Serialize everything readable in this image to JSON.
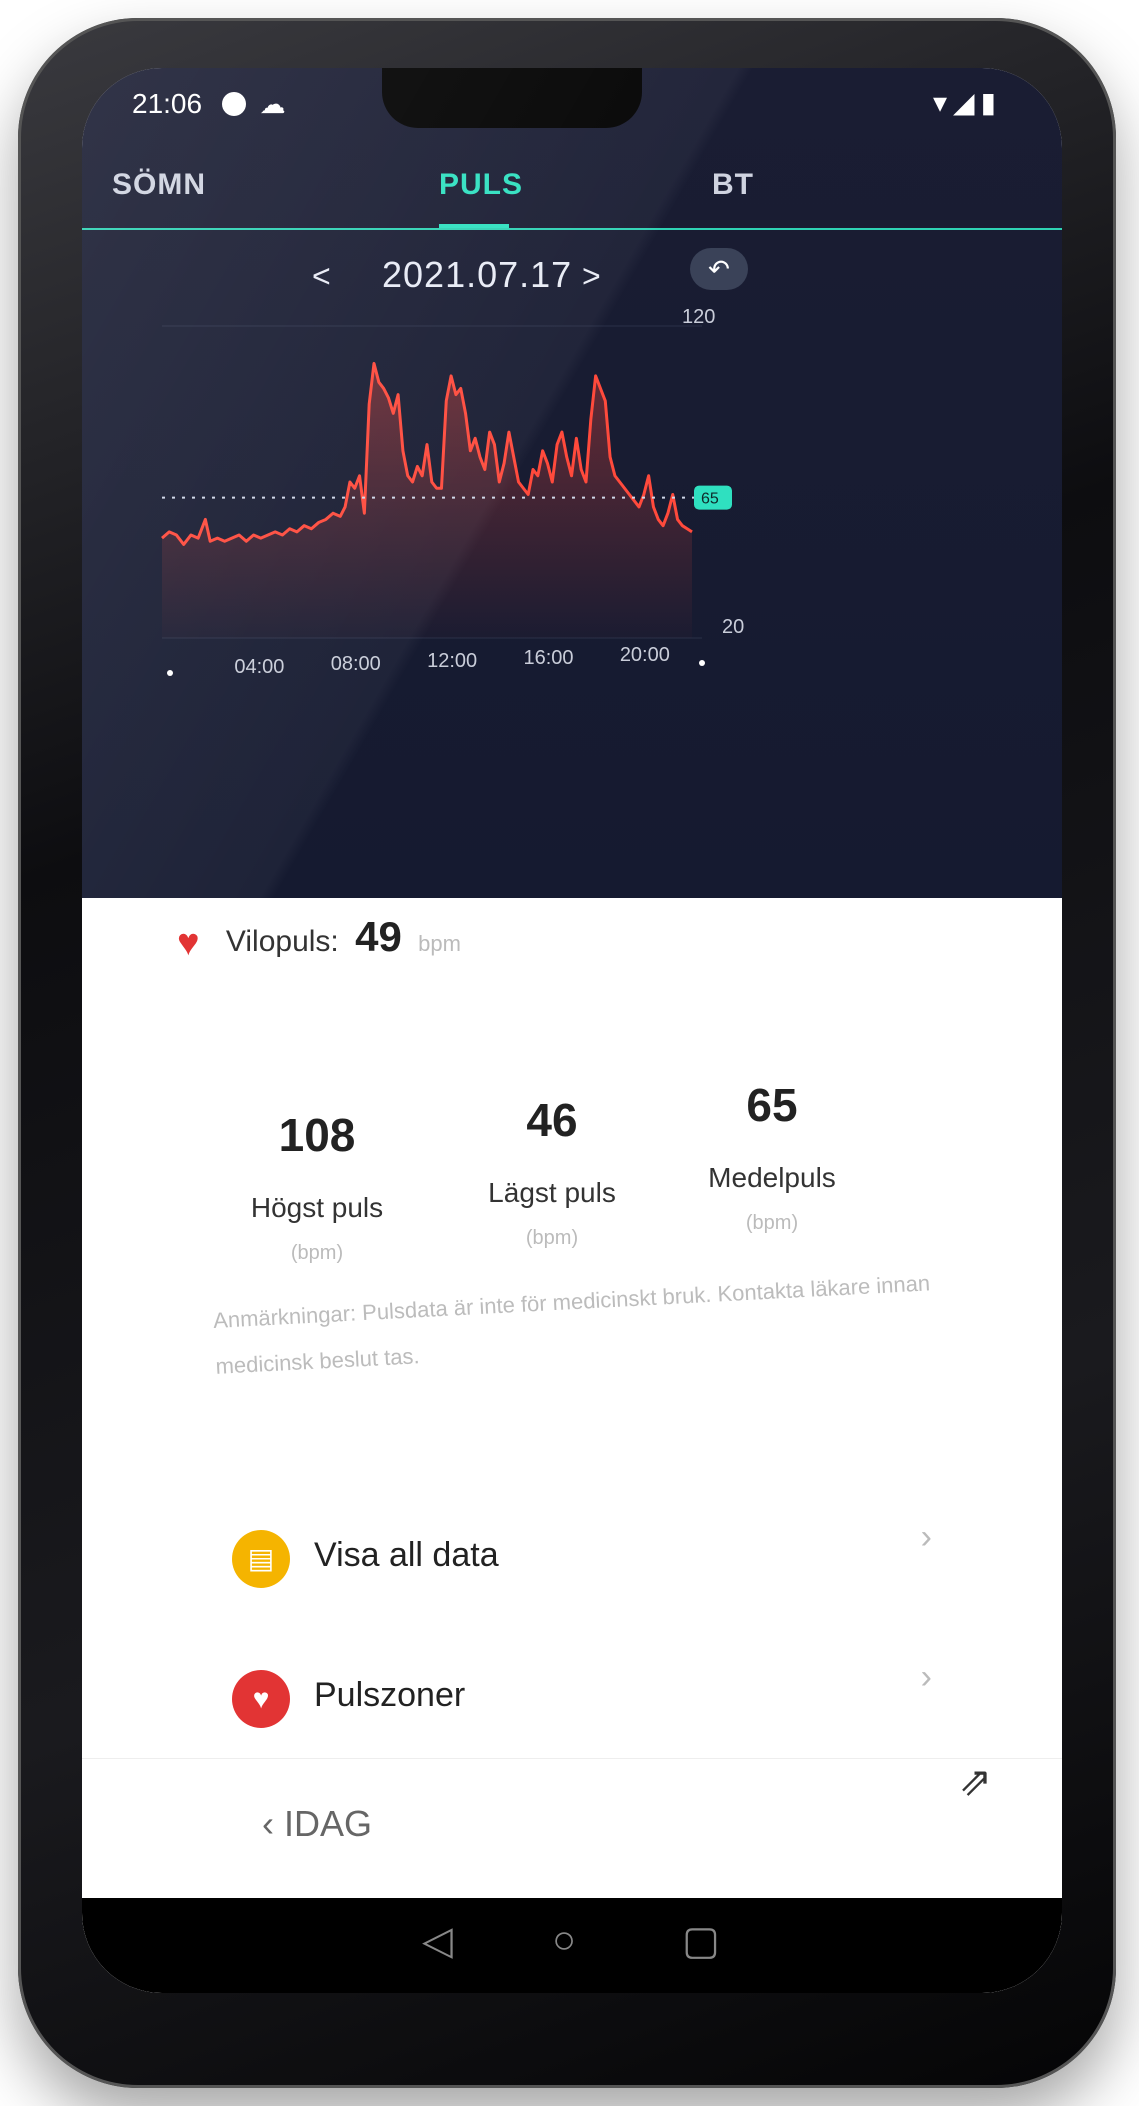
{
  "status": {
    "time": "21:06",
    "icons": "▾◢▮"
  },
  "tabs": [
    {
      "label": "SÖMN"
    },
    {
      "label": "PULS"
    },
    {
      "label": "BT"
    }
  ],
  "date_nav": {
    "prev": "<",
    "date": "2021.07.17",
    "next": ">",
    "undo_icon": "undo-icon"
  },
  "chart_data": {
    "type": "line",
    "x_ticks": [
      "04:00",
      "08:00",
      "12:00",
      "16:00",
      "20:00"
    ],
    "y_ticks": [
      120,
      20
    ],
    "ylim": [
      20,
      120
    ],
    "reference_line": {
      "value": 65,
      "label": "65"
    },
    "series": [
      {
        "color": "#ff4a3c",
        "points": [
          [
            0.0,
            52
          ],
          [
            0.3,
            54
          ],
          [
            0.6,
            53
          ],
          [
            0.9,
            50
          ],
          [
            1.2,
            53
          ],
          [
            1.5,
            52
          ],
          [
            1.8,
            58
          ],
          [
            2.0,
            51
          ],
          [
            2.3,
            52
          ],
          [
            2.6,
            51
          ],
          [
            2.9,
            52
          ],
          [
            3.2,
            53
          ],
          [
            3.5,
            51
          ],
          [
            3.8,
            53
          ],
          [
            4.1,
            52
          ],
          [
            4.4,
            53
          ],
          [
            4.7,
            54
          ],
          [
            5.0,
            53
          ],
          [
            5.3,
            55
          ],
          [
            5.6,
            54
          ],
          [
            5.9,
            56
          ],
          [
            6.2,
            55
          ],
          [
            6.5,
            57
          ],
          [
            6.8,
            58
          ],
          [
            7.1,
            60
          ],
          [
            7.4,
            59
          ],
          [
            7.6,
            62
          ],
          [
            7.8,
            70
          ],
          [
            8.0,
            68
          ],
          [
            8.2,
            72
          ],
          [
            8.4,
            60
          ],
          [
            8.6,
            95
          ],
          [
            8.8,
            108
          ],
          [
            9.0,
            102
          ],
          [
            9.2,
            100
          ],
          [
            9.4,
            97
          ],
          [
            9.6,
            92
          ],
          [
            9.8,
            98
          ],
          [
            10.0,
            80
          ],
          [
            10.2,
            72
          ],
          [
            10.4,
            70
          ],
          [
            10.6,
            75
          ],
          [
            10.8,
            72
          ],
          [
            11.0,
            82
          ],
          [
            11.2,
            70
          ],
          [
            11.4,
            68
          ],
          [
            11.6,
            68
          ],
          [
            11.8,
            96
          ],
          [
            12.0,
            104
          ],
          [
            12.2,
            98
          ],
          [
            12.4,
            100
          ],
          [
            12.6,
            92
          ],
          [
            12.8,
            80
          ],
          [
            13.0,
            84
          ],
          [
            13.2,
            78
          ],
          [
            13.4,
            74
          ],
          [
            13.6,
            86
          ],
          [
            13.8,
            82
          ],
          [
            14.0,
            70
          ],
          [
            14.2,
            76
          ],
          [
            14.4,
            86
          ],
          [
            14.6,
            78
          ],
          [
            14.8,
            70
          ],
          [
            15.0,
            68
          ],
          [
            15.2,
            66
          ],
          [
            15.4,
            74
          ],
          [
            15.6,
            72
          ],
          [
            15.8,
            80
          ],
          [
            16.0,
            76
          ],
          [
            16.2,
            70
          ],
          [
            16.4,
            82
          ],
          [
            16.6,
            86
          ],
          [
            16.8,
            78
          ],
          [
            17.0,
            72
          ],
          [
            17.2,
            84
          ],
          [
            17.4,
            74
          ],
          [
            17.6,
            70
          ],
          [
            17.8,
            90
          ],
          [
            18.0,
            104
          ],
          [
            18.2,
            100
          ],
          [
            18.4,
            96
          ],
          [
            18.6,
            78
          ],
          [
            18.8,
            72
          ],
          [
            19.0,
            70
          ],
          [
            19.2,
            68
          ],
          [
            19.4,
            66
          ],
          [
            19.6,
            64
          ],
          [
            19.8,
            62
          ],
          [
            20.0,
            66
          ],
          [
            20.2,
            72
          ],
          [
            20.4,
            62
          ],
          [
            20.6,
            58
          ],
          [
            20.8,
            56
          ],
          [
            21.0,
            60
          ],
          [
            21.2,
            66
          ],
          [
            21.4,
            58
          ],
          [
            21.6,
            56
          ],
          [
            21.8,
            55
          ],
          [
            22.0,
            54
          ]
        ]
      }
    ]
  },
  "resting": {
    "label": "Vilopuls:",
    "value": "49",
    "unit": "bpm"
  },
  "stats": [
    {
      "value": "108",
      "label": "Högst puls",
      "unit": "(bpm)"
    },
    {
      "value": "46",
      "label": "Lägst puls",
      "unit": "(bpm)"
    },
    {
      "value": "65",
      "label": "Medelpuls",
      "unit": "(bpm)"
    }
  ],
  "note": "Anmärkningar: Pulsdata är inte för medicinskt bruk. Kontakta läkare innan medicinsk beslut tas.",
  "menu": [
    {
      "label": "Visa all data",
      "icon": "document-icon",
      "color": "#f5b400"
    },
    {
      "label": "Pulszoner",
      "icon": "heart-icon",
      "color": "#e23434"
    }
  ],
  "bottom": {
    "back_label": "IDAG"
  },
  "colors": {
    "accent": "#2fe0c0",
    "chart_line": "#ff4a3c",
    "bg_dark": "#1a1d33"
  }
}
